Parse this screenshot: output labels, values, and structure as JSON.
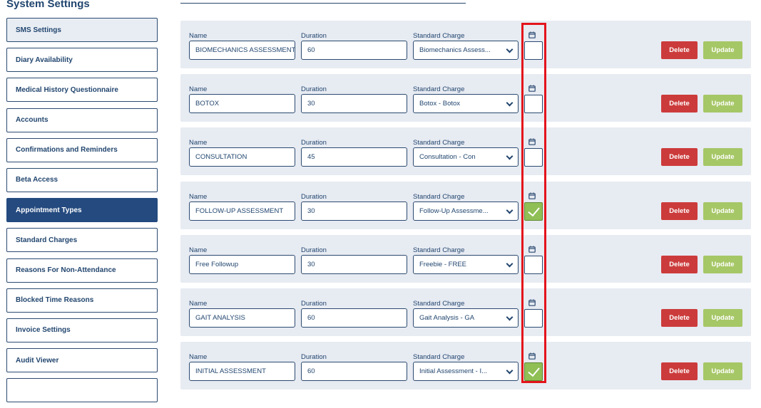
{
  "page_title": "System Settings",
  "sidebar": {
    "items": [
      {
        "label": "SMS Settings"
      },
      {
        "label": "Diary Availability"
      },
      {
        "label": "Medical History Questionnaire"
      },
      {
        "label": "Accounts"
      },
      {
        "label": "Confirmations and Reminders"
      },
      {
        "label": "Beta Access"
      },
      {
        "label": "Appointment Types"
      },
      {
        "label": "Standard Charges"
      },
      {
        "label": "Reasons For Non-Attendance"
      },
      {
        "label": "Blocked Time Reasons"
      },
      {
        "label": "Invoice Settings"
      },
      {
        "label": "Audit Viewer"
      }
    ],
    "active_item": "Appointment Types"
  },
  "fields": {
    "name_label": "Name",
    "duration_label": "Duration",
    "charge_label": "Standard Charge"
  },
  "buttons": {
    "delete_label": "Delete",
    "update_label": "Update"
  },
  "icons": {
    "online_booking": "calendar-icon",
    "dropdown": "chevron-down-icon",
    "checked": "checkmark-icon"
  },
  "colors": {
    "primary": "#244a7f",
    "delete": "#cc3b3b",
    "update": "#a6c766",
    "checked": "#8fbf55",
    "highlight": "#e3141c"
  },
  "appointment_types": [
    {
      "name": "BIOMECHANICS ASSESSMENT",
      "duration": "60",
      "charge": "Biomechanics Assess...",
      "checked": false
    },
    {
      "name": "BOTOX",
      "duration": "30",
      "charge": "Botox - Botox",
      "checked": false
    },
    {
      "name": "CONSULTATION",
      "duration": "45",
      "charge": "Consultation - Con",
      "checked": false
    },
    {
      "name": "FOLLOW-UP ASSESSMENT",
      "duration": "30",
      "charge": "Follow-Up Assessme...",
      "checked": true
    },
    {
      "name": "Free Followup",
      "duration": "30",
      "charge": "Freebie - FREE",
      "checked": false
    },
    {
      "name": "GAIT ANALYSIS",
      "duration": "60",
      "charge": "Gait Analysis - GA",
      "checked": false
    },
    {
      "name": "INITIAL ASSESSMENT",
      "duration": "60",
      "charge": "Initial Assessment - I...",
      "checked": true
    }
  ]
}
